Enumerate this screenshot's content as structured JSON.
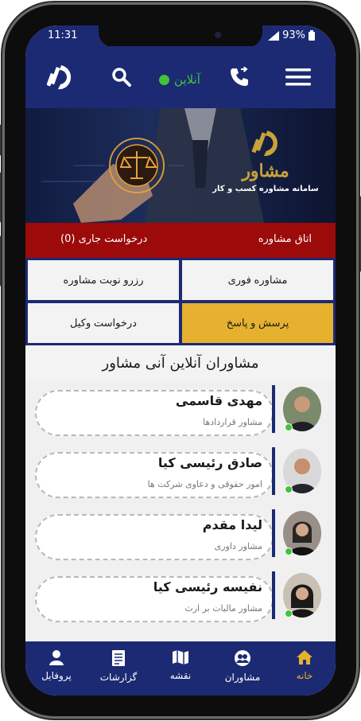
{
  "status_bar": {
    "time": "11:31",
    "battery": "93%"
  },
  "top_bar": {
    "online_status": "آنلاین"
  },
  "banner": {
    "brand_name": "مشاور",
    "brand_subtitle": "سامانه مشاوره کسب و کار"
  },
  "red_bar": {
    "room_label": "اتاق مشاوره",
    "current_request_label": "درخواست جاری (0)"
  },
  "action_grid": {
    "instant_consult": "مشاوره فوری",
    "book_appointment": "رزرو نوبت مشاوره",
    "qa": "پرسش و پاسخ",
    "request_lawyer": "درخواست وکیل"
  },
  "section_title": "مشاوران آنلاین آنی مشاور",
  "advisors": [
    {
      "name": "مهدی قاسمی",
      "role": "مشاور قراردادها"
    },
    {
      "name": "صادق رئیسی کیا",
      "role": "امور حقوقی و دعاوی شرکت ها"
    },
    {
      "name": "لیدا مقدم",
      "role": "مشاور داوری"
    },
    {
      "name": "نفیسه رئیسی کیا",
      "role": "مشاور مالیات بر ارث"
    }
  ],
  "bottom_nav": [
    {
      "label": "خانه",
      "icon": "home-icon",
      "active": true
    },
    {
      "label": "مشاوران",
      "icon": "advisors-icon",
      "active": false
    },
    {
      "label": "نقشه",
      "icon": "map-icon",
      "active": false
    },
    {
      "label": "گزارشات",
      "icon": "reports-icon",
      "active": false
    },
    {
      "label": "پروفایل",
      "icon": "profile-icon",
      "active": false
    }
  ],
  "colors": {
    "primary": "#1c2a73",
    "accent": "#e6b12f",
    "danger": "#9c0a0a",
    "online": "#3fc43a"
  }
}
